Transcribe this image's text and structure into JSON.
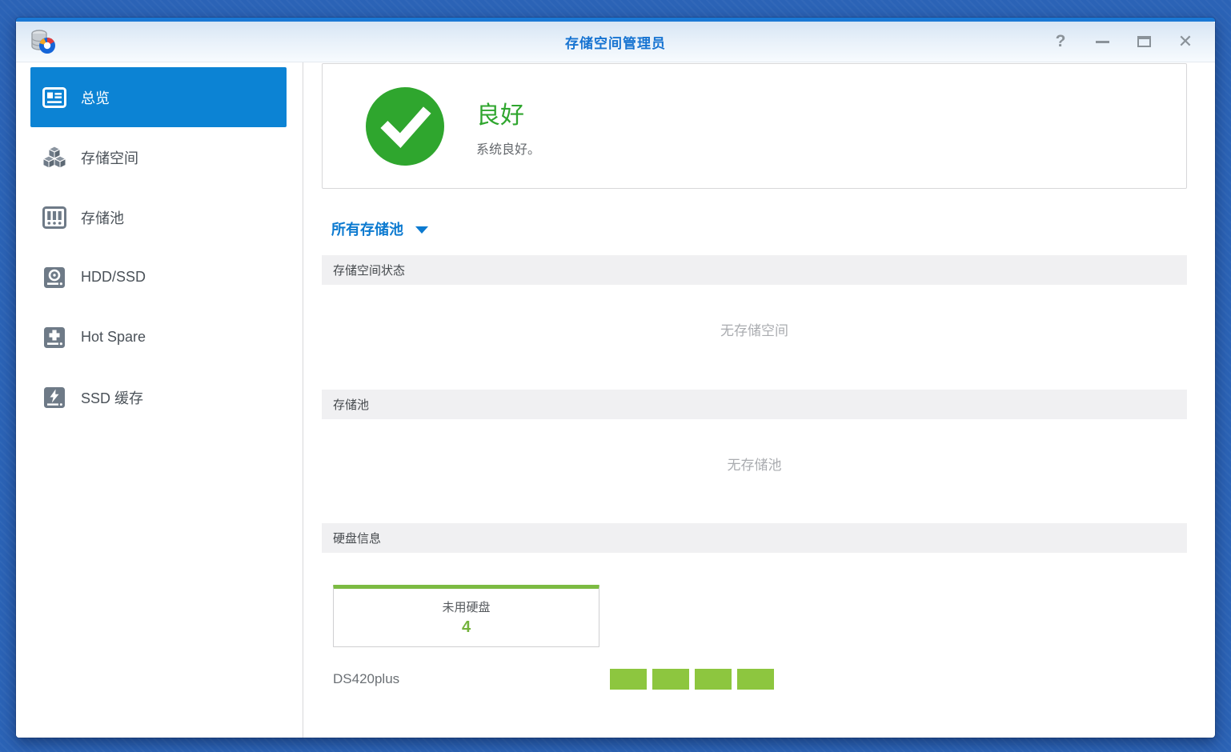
{
  "window": {
    "title": "存储空间管理员",
    "controls": {
      "help": "?",
      "close": "✕"
    }
  },
  "sidebar": {
    "items": [
      {
        "label": "总览",
        "icon": "overview-icon",
        "active": true
      },
      {
        "label": "存储空间",
        "icon": "storage-volume-icon",
        "active": false
      },
      {
        "label": "存储池",
        "icon": "storage-pool-icon",
        "active": false
      },
      {
        "label": "HDD/SSD",
        "icon": "hdd-ssd-icon",
        "active": false
      },
      {
        "label": "Hot Spare",
        "icon": "hot-spare-icon",
        "active": false
      },
      {
        "label": "SSD 缓存",
        "icon": "ssd-cache-icon",
        "active": false
      }
    ]
  },
  "main": {
    "health": {
      "title": "良好",
      "subtitle": "系统良好。"
    },
    "pool_selector": {
      "label": "所有存储池"
    },
    "sections": {
      "volume_status": {
        "title": "存储空间状态",
        "empty": "无存储空间"
      },
      "storage_pool": {
        "title": "存储池",
        "empty": "无存储池"
      },
      "disk_info": {
        "title": "硬盘信息"
      }
    },
    "disk_info": {
      "unused_label": "未用硬盘",
      "unused_count": "4",
      "model": "DS420plus",
      "slot_count": 4
    }
  },
  "colors": {
    "accent_blue": "#0c83d4",
    "title_blue": "#1673d1",
    "health_green": "#2fa62e",
    "disk_green": "#8dc63f"
  }
}
